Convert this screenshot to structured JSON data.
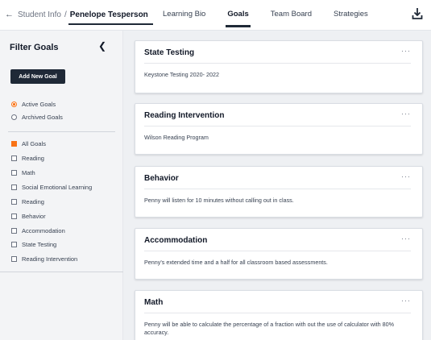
{
  "breadcrumb": {
    "parent": "Student Info",
    "separator": "/",
    "current": "Penelope Tesperson"
  },
  "tabs": [
    "Learning Bio",
    "Goals",
    "Team Board",
    "Strategies"
  ],
  "active_tab": "Goals",
  "sidebar": {
    "title": "Filter Goals",
    "add_button": "Add New Goal",
    "status_filters": [
      {
        "label": "Active Goals",
        "selected": true
      },
      {
        "label": "Archived Goals",
        "selected": false
      }
    ],
    "category_filters": [
      {
        "label": "All Goals",
        "checked": true
      },
      {
        "label": "Reading",
        "checked": false
      },
      {
        "label": "Math",
        "checked": false
      },
      {
        "label": "Social Emotional Learning",
        "checked": false
      },
      {
        "label": "Reading",
        "checked": false
      },
      {
        "label": "Behavior",
        "checked": false
      },
      {
        "label": "Accommodation",
        "checked": false
      },
      {
        "label": "State Testing",
        "checked": false
      },
      {
        "label": "Reading Intervention",
        "checked": false
      }
    ]
  },
  "goals": [
    {
      "title": "State Testing",
      "description": "Keystone Testing 2020- 2022"
    },
    {
      "title": "Reading Intervention",
      "description": "Wilson Reading Program"
    },
    {
      "title": "Behavior",
      "description": "Penny will listen for 10 minutes without calling out in class."
    },
    {
      "title": "Accommodation",
      "description": "Penny's extended time and a half for all classroom based assessments."
    },
    {
      "title": "Math",
      "description": "Penny will be able to calculate the percentage of a fraction with out the use of calculator with 80% accuracy."
    }
  ],
  "more_menu_label": "···",
  "icons": {
    "back": "arrow-left-icon",
    "collapse": "chevron-left-icon",
    "download": "download-icon"
  },
  "colors": {
    "accent": "#f97316",
    "dark": "#1f2937"
  }
}
